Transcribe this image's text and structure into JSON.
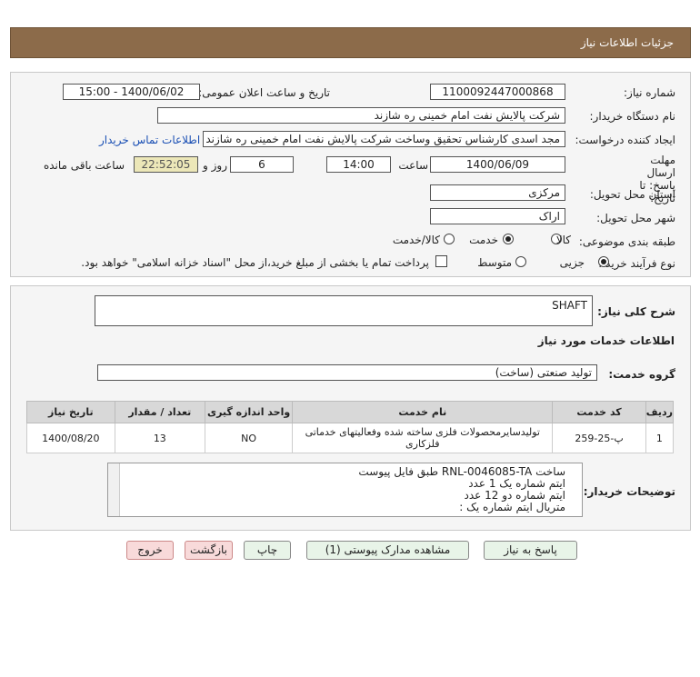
{
  "header": {
    "title": "جزئیات اطلاعات نیاز"
  },
  "need_number": {
    "label": "شماره نیاز:",
    "value": "1100092447000868"
  },
  "announce": {
    "label": "تاریخ و ساعت اعلان عمومی:",
    "value": "1400/06/02 - 15:00"
  },
  "buyer_org": {
    "label": "نام دستگاه خریدار:",
    "value": "شرکت پالایش نفت امام خمینی  ره  شازند"
  },
  "requester": {
    "label": "ایجاد کننده درخواست:",
    "value": "مجد اسدی کارشناس تحقیق وساخت شرکت پالایش نفت امام خمینی  ره  شازند",
    "contact_link": "اطلاعات تماس خریدار"
  },
  "deadline": {
    "label": "مهلت ارسال پاسخ: تا تاریخ:",
    "date": "1400/06/09",
    "time_label": "ساعت",
    "time": "14:00",
    "days": "6",
    "days_label": "روز و",
    "remaining": "22:52:05",
    "remaining_label": "ساعت باقی مانده"
  },
  "province": {
    "label": "استان محل تحویل:",
    "value": "مرکزی"
  },
  "city": {
    "label": "شهر محل تحویل:",
    "value": "اراک"
  },
  "category": {
    "label": "طبقه بندی موضوعی:",
    "options": [
      "کالا",
      "خدمت",
      "کالا/خدمت"
    ],
    "selected": "خدمت"
  },
  "purchase_type": {
    "label": "نوع فرآیند خرید :",
    "options": [
      "جزیی",
      "متوسط"
    ],
    "selected": "جزیی",
    "note": "پرداخت تمام یا بخشی از مبلغ خرید،از محل \"اسناد خزانه اسلامی\" خواهد بود."
  },
  "summary": {
    "label": "شرح کلی نیاز:",
    "value": "SHAFT"
  },
  "services_title": "اطلاعات خدمات مورد نیاز",
  "service_group": {
    "label": "گروه خدمت:",
    "value": "تولید صنعتی (ساخت)"
  },
  "table": {
    "headers": [
      "ردیف",
      "کد خدمت",
      "نام خدمت",
      "واحد اندازه گیری",
      "تعداد / مقدار",
      "تاریخ نیاز"
    ],
    "rows": [
      [
        "1",
        "پ-25-259",
        "تولیدسایرمحصولات فلزی ساخته شده وفعالیتهای خدماتی فلزکاری",
        "NO",
        "13",
        "1400/08/20"
      ]
    ]
  },
  "buyer_notes": {
    "label": "توضیحات خریدار:",
    "lines": [
      "ساخت RNL-0046085-TA طبق فایل پیوست",
      "ایتم شماره یک 1 عدد",
      "ایتم شماره دو 12 عدد",
      "متریال ایتم شماره یک :"
    ]
  },
  "buttons": {
    "reply": "پاسخ به نیاز",
    "attachments": "مشاهده مدارک پیوستی (1)",
    "print": "چاپ",
    "back": "بازگشت",
    "exit": "خروج"
  }
}
